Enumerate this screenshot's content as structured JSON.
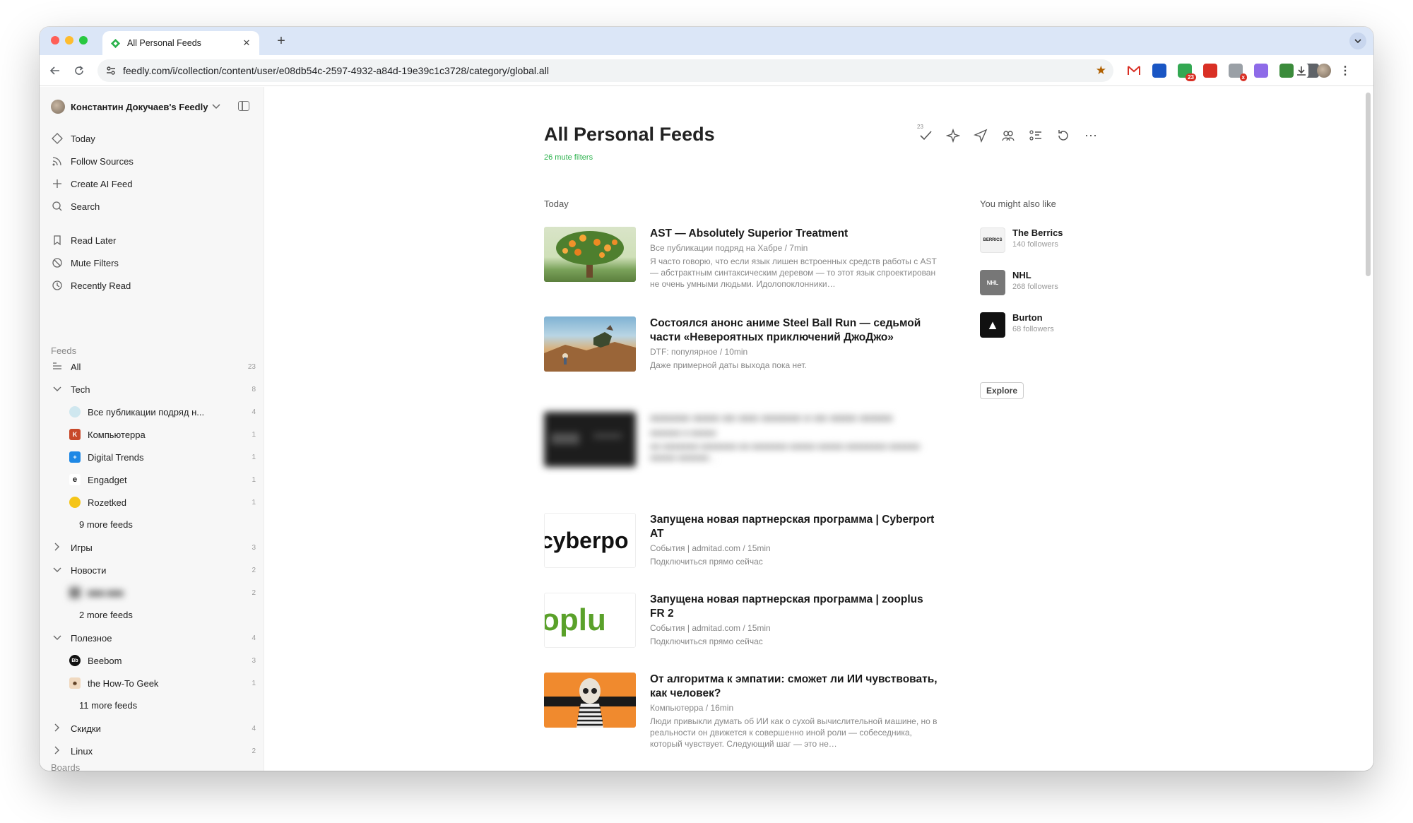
{
  "browser": {
    "tab_title": "All Personal Feeds",
    "tab_close": "✕",
    "new_tab": "+",
    "url": "feedly.com/i/collection/content/user/e08db54c-2597-4932-a84d-19e39c1c3728/category/global.all",
    "extensions": [
      {
        "name": "gmail-extension-icon",
        "color": "#ffffff"
      },
      {
        "name": "blue-extension-icon",
        "color": "#1a56c4"
      },
      {
        "name": "green-extension-icon",
        "color": "#33a852",
        "badge": "23"
      },
      {
        "name": "red-extension-icon",
        "color": "#d93025"
      },
      {
        "name": "gray-extension-icon",
        "color": "#9aa0a6",
        "badge": "x"
      },
      {
        "name": "purple-extension-icon",
        "color": "#8e6be8"
      },
      {
        "name": "camera-extension-icon",
        "color": "#3b8b3b"
      },
      {
        "name": "puzzle-extension-icon",
        "color": "#5f6368"
      }
    ]
  },
  "sidebar": {
    "account": "Константин Докучаев's Feedly",
    "nav": [
      {
        "label": "Today",
        "icon": "today-icon"
      },
      {
        "label": "Follow Sources",
        "icon": "rss-icon"
      },
      {
        "label": "Create AI Feed",
        "icon": "plus-icon"
      },
      {
        "label": "Search",
        "icon": "search-icon"
      }
    ],
    "nav2": [
      {
        "label": "Read Later",
        "icon": "bookmark-icon"
      },
      {
        "label": "Mute Filters",
        "icon": "mute-icon"
      },
      {
        "label": "Recently Read",
        "icon": "clock-icon"
      }
    ],
    "feeds_heading": "Feeds",
    "all_label": "All",
    "all_count": "23",
    "groups": {
      "tech": {
        "label": "Tech",
        "count": "8"
      },
      "games": {
        "label": "Игры",
        "count": "3"
      },
      "news": {
        "label": "Новости",
        "count": "2"
      },
      "useful": {
        "label": "Полезное",
        "count": "4"
      },
      "discounts": {
        "label": "Скидки",
        "count": "4"
      },
      "linux": {
        "label": "Linux",
        "count": "2"
      }
    },
    "tech_feeds": [
      {
        "label": "Все публикации подряд н...",
        "count": "4",
        "color": "#cfe7ef"
      },
      {
        "label": "Компьютерра",
        "count": "1",
        "color": "#c8492a"
      },
      {
        "label": "Digital Trends",
        "count": "1",
        "color": "#1e88e5"
      },
      {
        "label": "Engadget",
        "count": "1",
        "color": "#ffffff"
      },
      {
        "label": "Rozetked",
        "count": "1",
        "color": "#f5c518"
      }
    ],
    "tech_more": "9 more feeds",
    "news_feed": {
      "label": "■■■ ■■■",
      "count": "2"
    },
    "news_more": "2 more feeds",
    "useful_feeds": [
      {
        "label": "Beebom",
        "count": "3",
        "color": "#111111"
      },
      {
        "label": "the How-To Geek",
        "count": "1",
        "color": "#f0d9c0"
      }
    ],
    "useful_more": "11 more feeds",
    "boards_heading": "Boards"
  },
  "main": {
    "title": "All Personal Feeds",
    "mute_filters": "26 mute filters",
    "unread_count": "23",
    "section_today": "Today",
    "articles": [
      {
        "title": "AST — Absolutely Superior Treatment",
        "meta": "Все публикации подряд на Хабре / 7min",
        "summary": "Я часто говорю, что если язык лишен встроенных средств работы с AST — абстрактным синтаксическим деревом — то этот язык спроектирован не очень умными людьми. Идолопоклонники…"
      },
      {
        "title": "Состоялся анонс аниме Steel Ball Run — седьмой части «Невероятных приключений ДжоДжо»",
        "meta": "DTF: популярное / 10min",
        "summary": "Даже примерной даты выхода пока нет."
      },
      {
        "title": "■■■■■■ ■■■■ ■■ ■■■ ■■■■■■ ■ ■■ ■■■■ ■■■■■",
        "meta": "■■■■■■ ■ ■■■■■",
        "summary": "■■ ■■■■■■■ ■■■■■■■ ■■ ■■■■■■■ ■■■■■ ■■■■■ ■■■■■■■■ ■■■■■■ ■■■■■ ■■■■■■…"
      },
      {
        "title": "Запущена новая партнерская программа | Cyberport AT",
        "meta": "События | admitad.com / 15min",
        "summary": "Подключиться прямо сейчас",
        "thumb_text": "cyberpo"
      },
      {
        "title": "Запущена новая партнерская программа | zooplus FR 2",
        "meta": "События | admitad.com / 15min",
        "summary": "Подключиться прямо сейчас",
        "thumb_text": "oplu"
      },
      {
        "title": "От алгоритма к эмпатии: сможет ли ИИ чувствовать, как человек?",
        "meta": "Компьютерра / 16min",
        "summary": "Люди привыкли думать об ИИ как о сухой вычислительной машине, но в реальности он движется к совершенно иной роли — собеседника, который чувствует. Следующий шаг — это не…"
      }
    ],
    "also_heading": "You might also like",
    "recommendations": [
      {
        "name": "The Berrics",
        "followers": "140 followers",
        "logo_text": "BERRICS"
      },
      {
        "name": "NHL",
        "followers": "268 followers",
        "logo_text": "NHL"
      },
      {
        "name": "Burton",
        "followers": "68 followers",
        "logo_text": "▲"
      }
    ],
    "explore_label": "Explore"
  }
}
